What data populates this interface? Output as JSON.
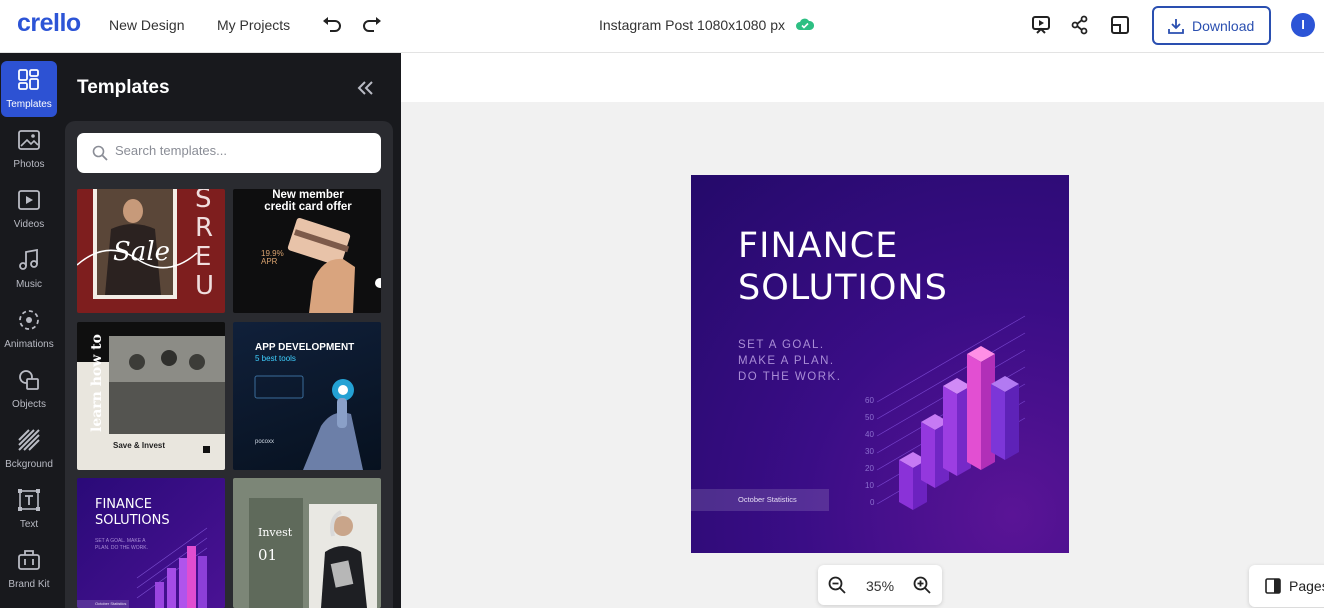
{
  "app": {
    "logo": "crello"
  },
  "nav": {
    "new_design": "New Design",
    "my_projects": "My Projects"
  },
  "document": {
    "title": "Instagram Post 1080x1080 px"
  },
  "toolbar": {
    "download_label": "Download"
  },
  "user": {
    "initial": "I"
  },
  "rail": {
    "items": [
      {
        "label": "Templates",
        "icon": "templates-icon",
        "active": true
      },
      {
        "label": "Photos",
        "icon": "photo-icon"
      },
      {
        "label": "Videos",
        "icon": "video-icon"
      },
      {
        "label": "Music",
        "icon": "music-icon"
      },
      {
        "label": "Animations",
        "icon": "animations-icon"
      },
      {
        "label": "Objects",
        "icon": "objects-icon"
      },
      {
        "label": "Bckground",
        "icon": "background-icon"
      },
      {
        "label": "Text",
        "icon": "text-icon"
      },
      {
        "label": "Brand Kit",
        "icon": "brand-kit-icon"
      }
    ]
  },
  "panel": {
    "title": "Templates",
    "search_placeholder": "Search templates...",
    "templates": [
      {
        "text": "Sale",
        "side_text": "SREU"
      },
      {
        "title": "New member credit card offer",
        "apr_rate": "19.9%",
        "apr_label": "APR"
      },
      {
        "vertical": "learn how to",
        "caption": "Save & Invest"
      },
      {
        "title": "APP DEVELOPMENT",
        "subtitle": "5 best tools",
        "brand": "pocoxx"
      },
      {
        "title": "FINANCE SOLUTIONS",
        "sub": "SET A GOAL. MAKE A PLAN. DO THE WORK.",
        "banner": "October Statistics"
      },
      {
        "title": "Invest",
        "number": "01"
      }
    ]
  },
  "design": {
    "title_line1": "FINANCE",
    "title_line2": "SOLUTIONS",
    "sub_line1": "SET A GOAL.",
    "sub_line2": "MAKE A PLAN.",
    "sub_line3": "DO THE WORK.",
    "banner": "October Statistics",
    "axis_ticks": [
      "60",
      "50",
      "40",
      "30",
      "20",
      "10",
      "0"
    ]
  },
  "zoom": {
    "value": "35%"
  },
  "pages": {
    "label": "Pages"
  },
  "colors": {
    "accent": "#2c54d6",
    "rail_bg": "#18191d",
    "panel_bg": "#2a2b30",
    "design_bg": "#3a0d86"
  }
}
